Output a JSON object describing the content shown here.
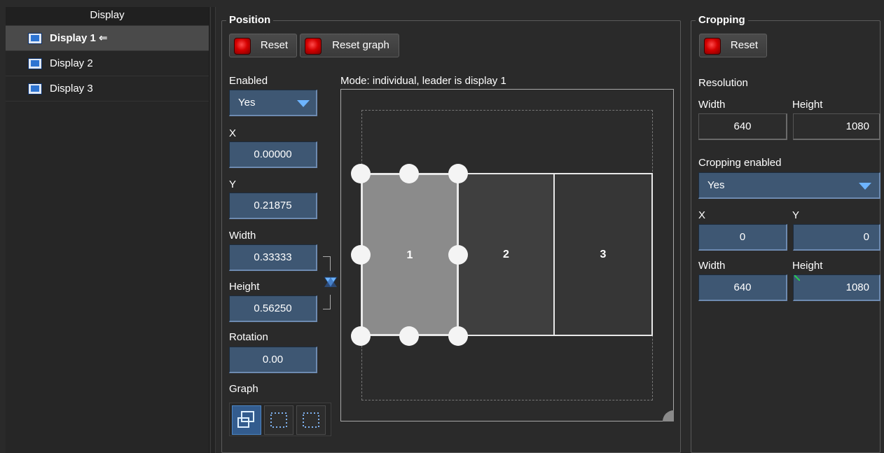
{
  "display_list": {
    "header": "Display",
    "items": [
      {
        "label": "Display 1 ⇐",
        "selected": true
      },
      {
        "label": "Display 2",
        "selected": false
      },
      {
        "label": "Display 3",
        "selected": false
      }
    ]
  },
  "position": {
    "title": "Position",
    "reset_label": "Reset",
    "reset_graph_label": "Reset graph",
    "enabled_label": "Enabled",
    "enabled_value": "Yes",
    "x_label": "X",
    "x_value": "0.00000",
    "y_label": "Y",
    "y_value": "0.21875",
    "width_label": "Width",
    "width_value": "0.33333",
    "height_label": "Height",
    "height_value": "0.56250",
    "rotation_label": "Rotation",
    "rotation_value": "0.00",
    "graph_label": "Graph",
    "mode_text": "Mode: individual, leader is display 1",
    "displays": [
      "1",
      "2",
      "3"
    ]
  },
  "cropping": {
    "title": "Cropping",
    "reset_label": "Reset",
    "resolution_label": "Resolution",
    "res_width_label": "Width",
    "res_height_label": "Height",
    "res_width_value": "640",
    "res_height_value": "1080",
    "cropping_enabled_label": "Cropping enabled",
    "cropping_enabled_value": "Yes",
    "x_label": "X",
    "y_label": "Y",
    "x_value": "0",
    "y_value": "0",
    "width_label": "Width",
    "height_label": "Height",
    "width_value": "640",
    "height_value": "1080"
  },
  "colors": {
    "field_bg": "#3e5773",
    "accent_blue": "#6db4ff",
    "reset_red": "#d40000",
    "selected_row": "#4a4a4a"
  },
  "icons": {
    "monitor": "monitor-icon",
    "reset": "red-square-icon",
    "dropdown": "triangle-down-icon",
    "aspect_lock": "aspect-lock-icon",
    "graph_overlap": "overlap-squares-icon",
    "graph_dotted": "dotted-square-icon"
  }
}
